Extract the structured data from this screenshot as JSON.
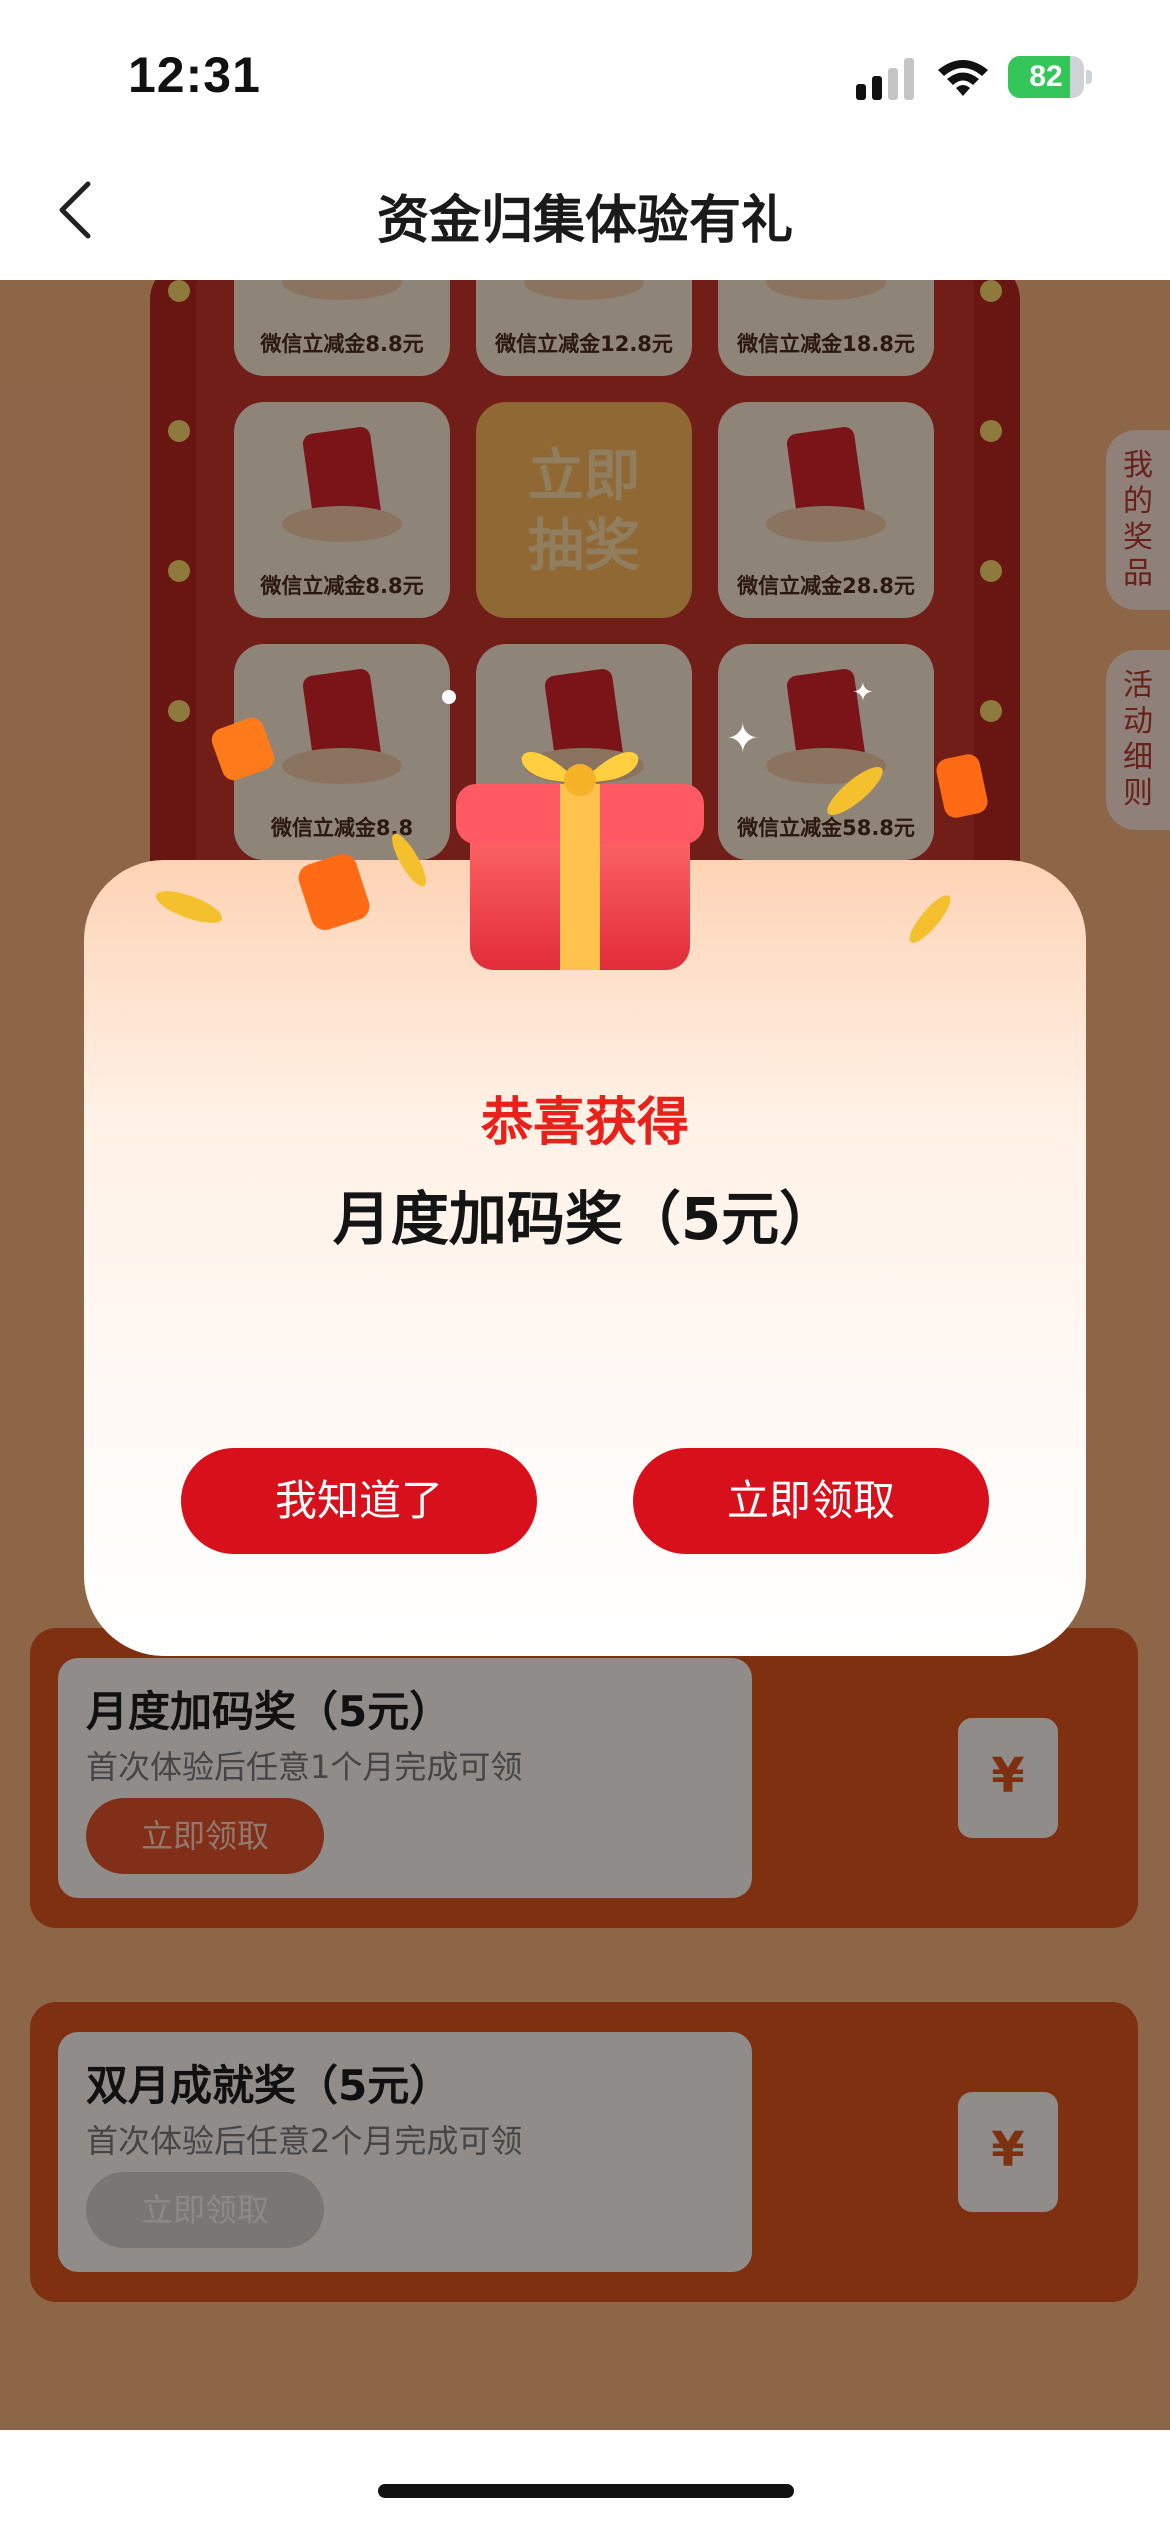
{
  "status_bar": {
    "time": "12:31",
    "battery_percent": "82",
    "battery_level": 0.82,
    "icons": [
      "signal-icon",
      "wifi-icon",
      "battery-icon"
    ]
  },
  "nav": {
    "title": "资金归集体验有礼",
    "back_icon": "chevron-left-icon"
  },
  "lottery": {
    "cells": [
      {
        "label": "微信立减金8.8元"
      },
      {
        "label": "微信立减金12.8元"
      },
      {
        "label": "微信立减金18.8元"
      },
      {
        "label": "微信立减金8.8元"
      },
      {
        "label": "立即抽奖"
      },
      {
        "label": "微信立减金28.8元"
      },
      {
        "label": "微信立减金8.8"
      },
      {
        "label": ""
      },
      {
        "label": "微信立减金58.8元"
      }
    ],
    "draw_line1": "立即",
    "draw_line2": "抽奖"
  },
  "side_tabs": {
    "my_prizes": "我的奖品",
    "rules": "活动细则"
  },
  "rewards": [
    {
      "title": "月度加码奖（5元）",
      "desc": "首次体验后任意1个月完成可领",
      "button": "立即领取",
      "enabled": true
    },
    {
      "title": "双月成就奖（5元）",
      "desc": "首次体验后任意2个月完成可领",
      "button": "立即领取",
      "enabled": false
    }
  ],
  "modal": {
    "congrats": "恭喜获得",
    "prize": "月度加码奖（5元）",
    "dismiss_button": "我知道了",
    "claim_button": "立即领取"
  },
  "colors": {
    "accent_red": "#d7101c",
    "congrats_red": "#e6221b",
    "battery_green": "#35c659"
  }
}
